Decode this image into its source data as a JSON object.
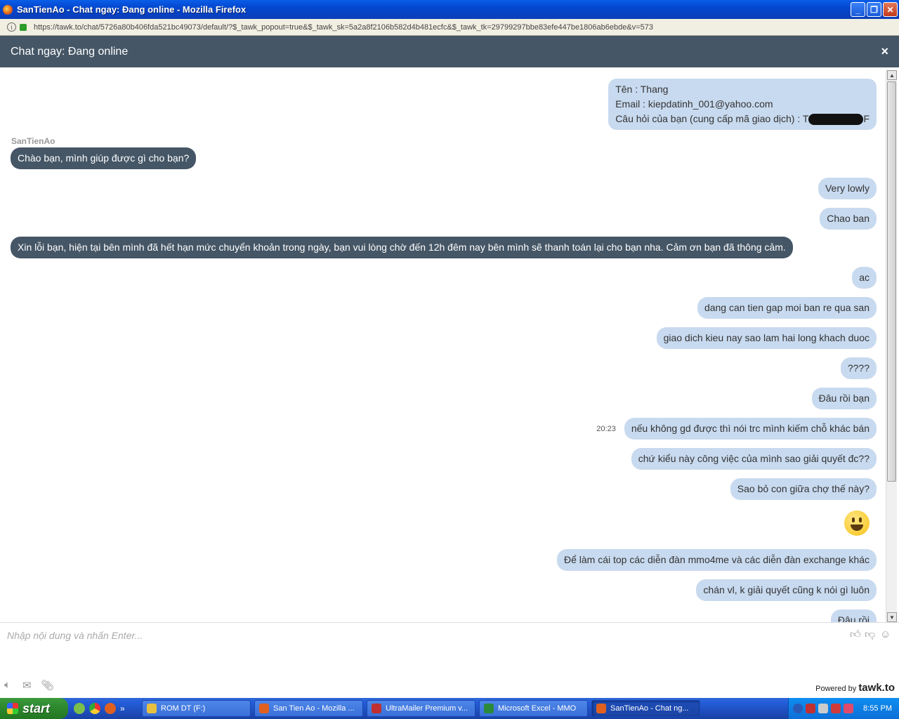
{
  "window": {
    "title": "SanTienAo - Chat ngay: Đang online - Mozilla Firefox"
  },
  "browser": {
    "url": "https://tawk.to/chat/5726a80b406fda521bc49073/default/?$_tawk_popout=true&$_tawk_sk=5a2a8f2106b582d4b481ecfc&$_tawk_tk=29799297bbe83efe447be1806ab6ebde&v=573"
  },
  "chat": {
    "header_title": "Chat ngay: Đang online",
    "close_label": "×",
    "agent_name": "SanTienAo",
    "info": {
      "name_line": "Tên : Thang",
      "email_label": "Email : ",
      "email": "kiepdatinh_001@yahoo.com",
      "question_line": "Câu hỏi của bạn (cung cấp mã giao dịch) : T",
      "question_tail": "F"
    },
    "messages": [
      {
        "text": "Chào bạn, mình giúp được gì cho bạn?"
      },
      {
        "text": "Very lowly"
      },
      {
        "text": "Chao ban"
      },
      {
        "text": "Xin lỗi bạn, hiện tại bên mình đã hết hạn mức chuyển khoản trong ngày, bạn vui lòng chờ đến 12h đêm nay bên mình sẽ thanh toán lại cho bạn nha. Cảm ơn bạn đã thông cảm."
      },
      {
        "text": "ac"
      },
      {
        "text": "dang can tien gap moi ban re qua san"
      },
      {
        "text": "giao dich kieu nay sao lam hai long khach duoc"
      },
      {
        "text": "????"
      },
      {
        "text": "Đâu rồi bạn"
      },
      {
        "text": "nếu không gd được thì nói trc mình kiếm chỗ khác bán",
        "time": "20:23"
      },
      {
        "text": "chứ kiểu này công việc của mình sao giải quyết đc??"
      },
      {
        "text": "Sao bỏ con giữa chợ thế này?"
      },
      {
        "text": "Để làm cái top các diễn đàn mmo4me và các diễn đàn exchange khác"
      },
      {
        "text": "chán vl, k giải quyết cũng k nói gì luôn"
      },
      {
        "text": "Đâu rồi"
      }
    ],
    "input_placeholder": "Nhập nội dung và nhấn Enter...",
    "powered_label": "Powered by ",
    "powered_brand": "tawk.to"
  },
  "taskbar": {
    "start_label": "start",
    "items": [
      {
        "label": "ROM DT (F:)",
        "color": "#e8c040"
      },
      {
        "label": "San Tien Ao - Mozilla ...",
        "color": "#e06020"
      },
      {
        "label": "UltraMailer Premium v...",
        "color": "#c03030"
      },
      {
        "label": "Microsoft Excel - MMO",
        "color": "#2a8a3a"
      },
      {
        "label": "SanTienAo - Chat ng...",
        "color": "#e06020"
      }
    ],
    "clock": "8:55 PM"
  }
}
